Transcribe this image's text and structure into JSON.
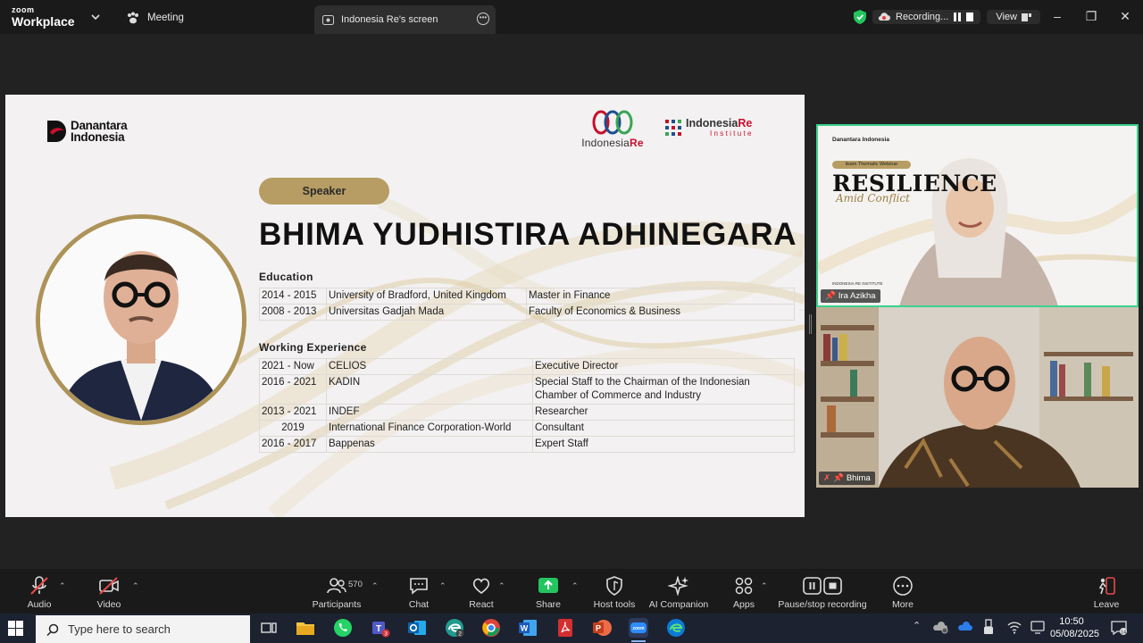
{
  "titlebar": {
    "brand_top": "zoom",
    "brand_bottom": "Workplace",
    "meeting_label": "Meeting",
    "share_tab_label": "Indonesia Re's screen",
    "recording_label": "Recording...",
    "view_label": "View"
  },
  "slide": {
    "danantara_line1": "Danantara",
    "danantara_line2": "Indonesia",
    "ire_text": "Indonesia",
    "ire_text_bold": "Re",
    "iri_text": "Indonesia",
    "iri_re": "Re",
    "iri_sub": "Institute",
    "speaker_badge": "Speaker",
    "speaker_name": "BHIMA YUDHISTIRA ADHINEGARA",
    "education_title": "Education",
    "education": [
      {
        "years": "2014 - 2015",
        "institution": "University of Bradford, United Kingdom",
        "degree": "Master in Finance"
      },
      {
        "years": "2008 - 2013",
        "institution": "Universitas Gadjah Mada",
        "degree": "Faculty of Economics & Business"
      }
    ],
    "work_title": "Working Experience",
    "work": [
      {
        "years": "2021 - Now",
        "org": "CELIOS",
        "role": "Executive Director"
      },
      {
        "years": "2016 - 2021",
        "org": "KADIN",
        "role": "Special Staff to the Chairman of the Indonesian Chamber of Commerce and Industry"
      },
      {
        "years": "2013 - 2021",
        "org": "INDEF",
        "role": "Researcher"
      },
      {
        "years": "2019",
        "org": "International Finance Corporation-World",
        "role": "Consultant"
      },
      {
        "years": "2016 - 2017",
        "org": "Bappenas",
        "role": "Expert Staff"
      }
    ]
  },
  "videos": {
    "top": {
      "name": "Ira Azikha",
      "bg_dan": "Danantara Indonesia",
      "bg_badge": "ilsam Thematic Webinar",
      "bg_title": "RESILIENCE",
      "bg_subtitle": "Amid Conflict",
      "bg_footer": "INDONESIA RE INSTITUTE"
    },
    "bottom": {
      "name": "Bhima"
    }
  },
  "controls": {
    "audio": "Audio",
    "video": "Video",
    "participants": "Participants",
    "participant_count": "570",
    "chat": "Chat",
    "react": "React",
    "share": "Share",
    "host_tools": "Host tools",
    "ai_companion": "AI Companion",
    "apps": "Apps",
    "pause_recording": "Pause/stop recording",
    "more": "More",
    "leave": "Leave"
  },
  "taskbar": {
    "search_placeholder": "Type here to search",
    "time": "10:50",
    "date": "05/08/2025",
    "notification_count": "14",
    "teams_badge": "3",
    "edge_badge": "2"
  },
  "colors": {
    "accent_green": "#39d28c",
    "gold": "#b79d63",
    "brand_red": "#c8102e",
    "share_green": "#22c55e"
  }
}
